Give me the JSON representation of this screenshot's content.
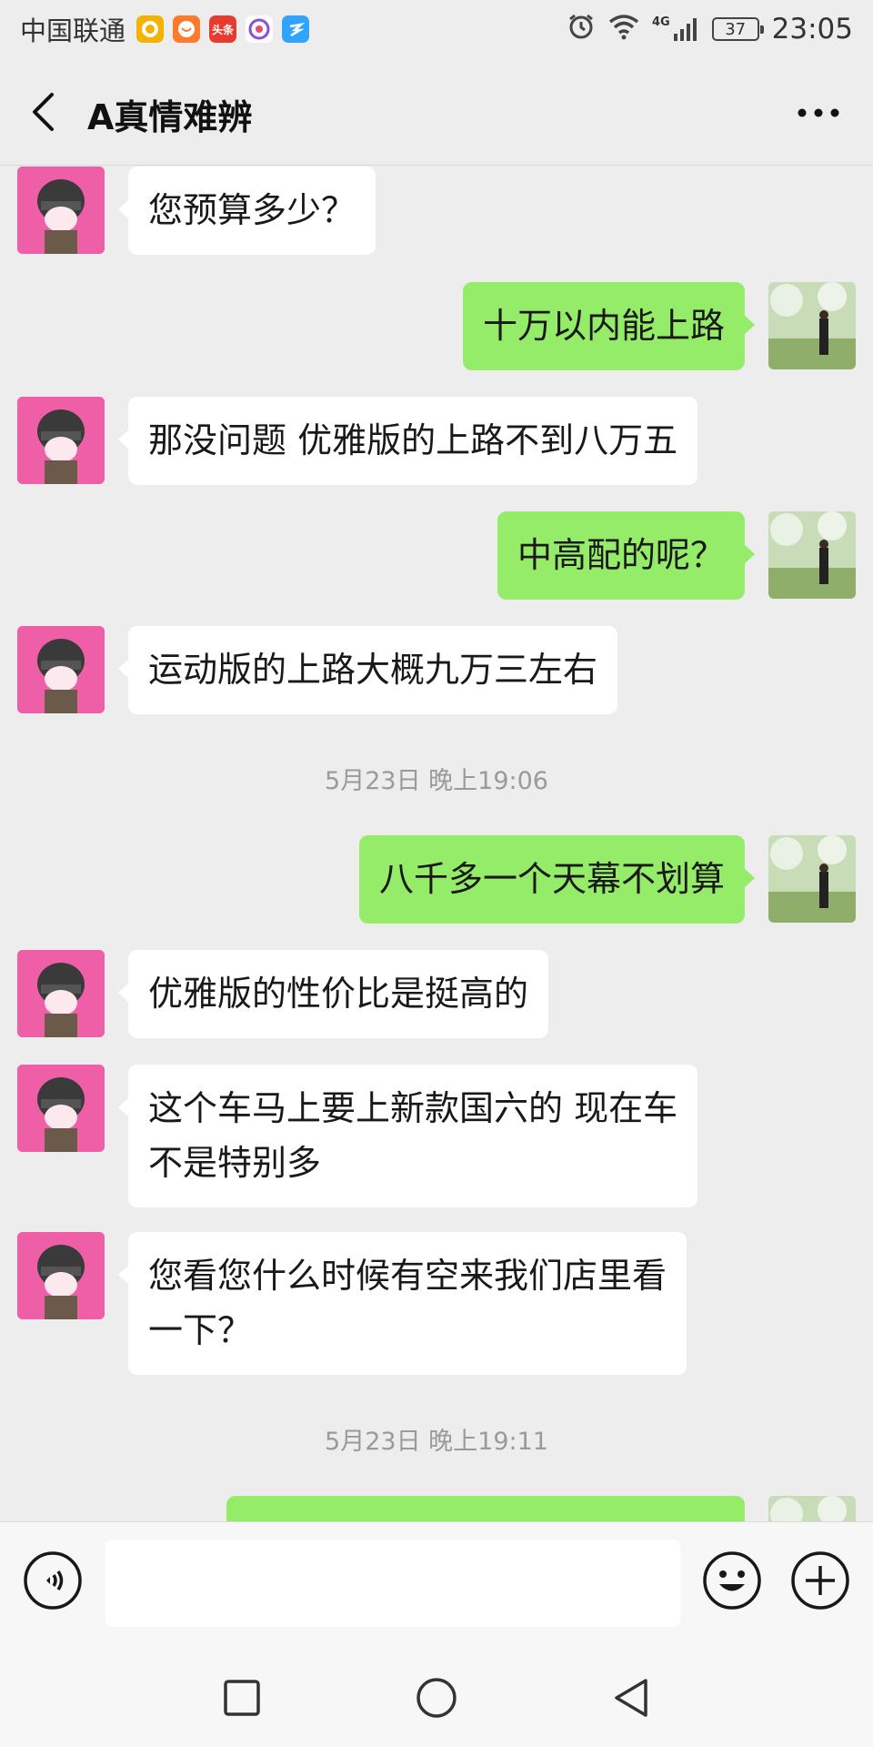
{
  "status_bar": {
    "carrier": "中国联通",
    "badge_toutiao": "头条",
    "battery": "37",
    "network": "4G",
    "time": "23:05"
  },
  "header": {
    "title": "A真情难辨"
  },
  "messages": [
    {
      "side": "left",
      "text": "您预算多少？"
    },
    {
      "side": "right",
      "text": "十万以内能上路"
    },
    {
      "side": "left",
      "text": "那没问题 优雅版的上路不到八万五"
    },
    {
      "side": "right",
      "text": "中高配的呢？"
    },
    {
      "side": "left",
      "text": "运动版的上路大概九万三左右"
    },
    {
      "side": "right",
      "text": "八千多一个天幕不划算"
    },
    {
      "side": "left",
      "text": "优雅版的性价比是挺高的"
    },
    {
      "side": "left",
      "lines": [
        "这个车马上要上新款国六的 现在车",
        "不是特别多"
      ]
    },
    {
      "side": "left",
      "lines": [
        "您看您什么时候有空来我们店里看",
        "一下？"
      ]
    },
    {
      "side": "right",
      "text": ""
    }
  ],
  "timestamps": [
    "5月23日 晚上19:06",
    "5月23日 晚上19:11"
  ],
  "input": {
    "placeholder": ""
  },
  "colors": {
    "background": "#ededed",
    "bubble_sent": "#95ec69",
    "bubble_received": "#ffffff",
    "timestamp_text": "#9a9a9a",
    "left_avatar": "#ee5fa8"
  },
  "icons": {
    "back": "back-arrow-icon",
    "more": "more-dots-icon",
    "voice": "voice-icon",
    "emoji": "emoji-icon",
    "plus": "plus-icon",
    "nav_recent": "square-icon",
    "nav_home": "circle-icon",
    "nav_back": "triangle-icon"
  }
}
